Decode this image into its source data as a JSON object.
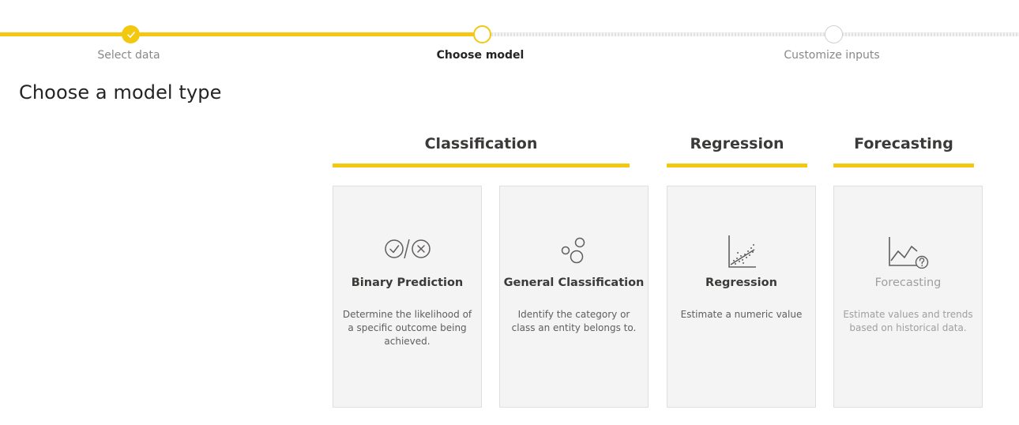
{
  "stepper": {
    "steps": [
      {
        "label": "Select data",
        "state": "complete"
      },
      {
        "label": "Choose model",
        "state": "current"
      },
      {
        "label": "Customize inputs",
        "state": "upcoming"
      }
    ]
  },
  "page": {
    "title": "Choose a model type"
  },
  "categories": [
    {
      "label": "Classification"
    },
    {
      "label": "Regression"
    },
    {
      "label": "Forecasting"
    }
  ],
  "cards": [
    {
      "title": "Binary Prediction",
      "description": "Determine the likelihood of a specific outcome being achieved.",
      "icon": "binary-check-cross-icon",
      "enabled": true
    },
    {
      "title": "General Classification",
      "description": "Identify the category or class an entity belongs to.",
      "icon": "bubbles-icon",
      "enabled": true
    },
    {
      "title": "Regression",
      "description": "Estimate a numeric value",
      "icon": "scatter-plot-icon",
      "enabled": true
    },
    {
      "title": "Forecasting",
      "description": "Estimate values and trends based on historical data.",
      "icon": "line-chart-question-icon",
      "enabled": false
    }
  ],
  "colors": {
    "accent": "#f2c811",
    "card_bg": "#f4f4f4",
    "text": "#252423",
    "muted": "#8a8886"
  }
}
